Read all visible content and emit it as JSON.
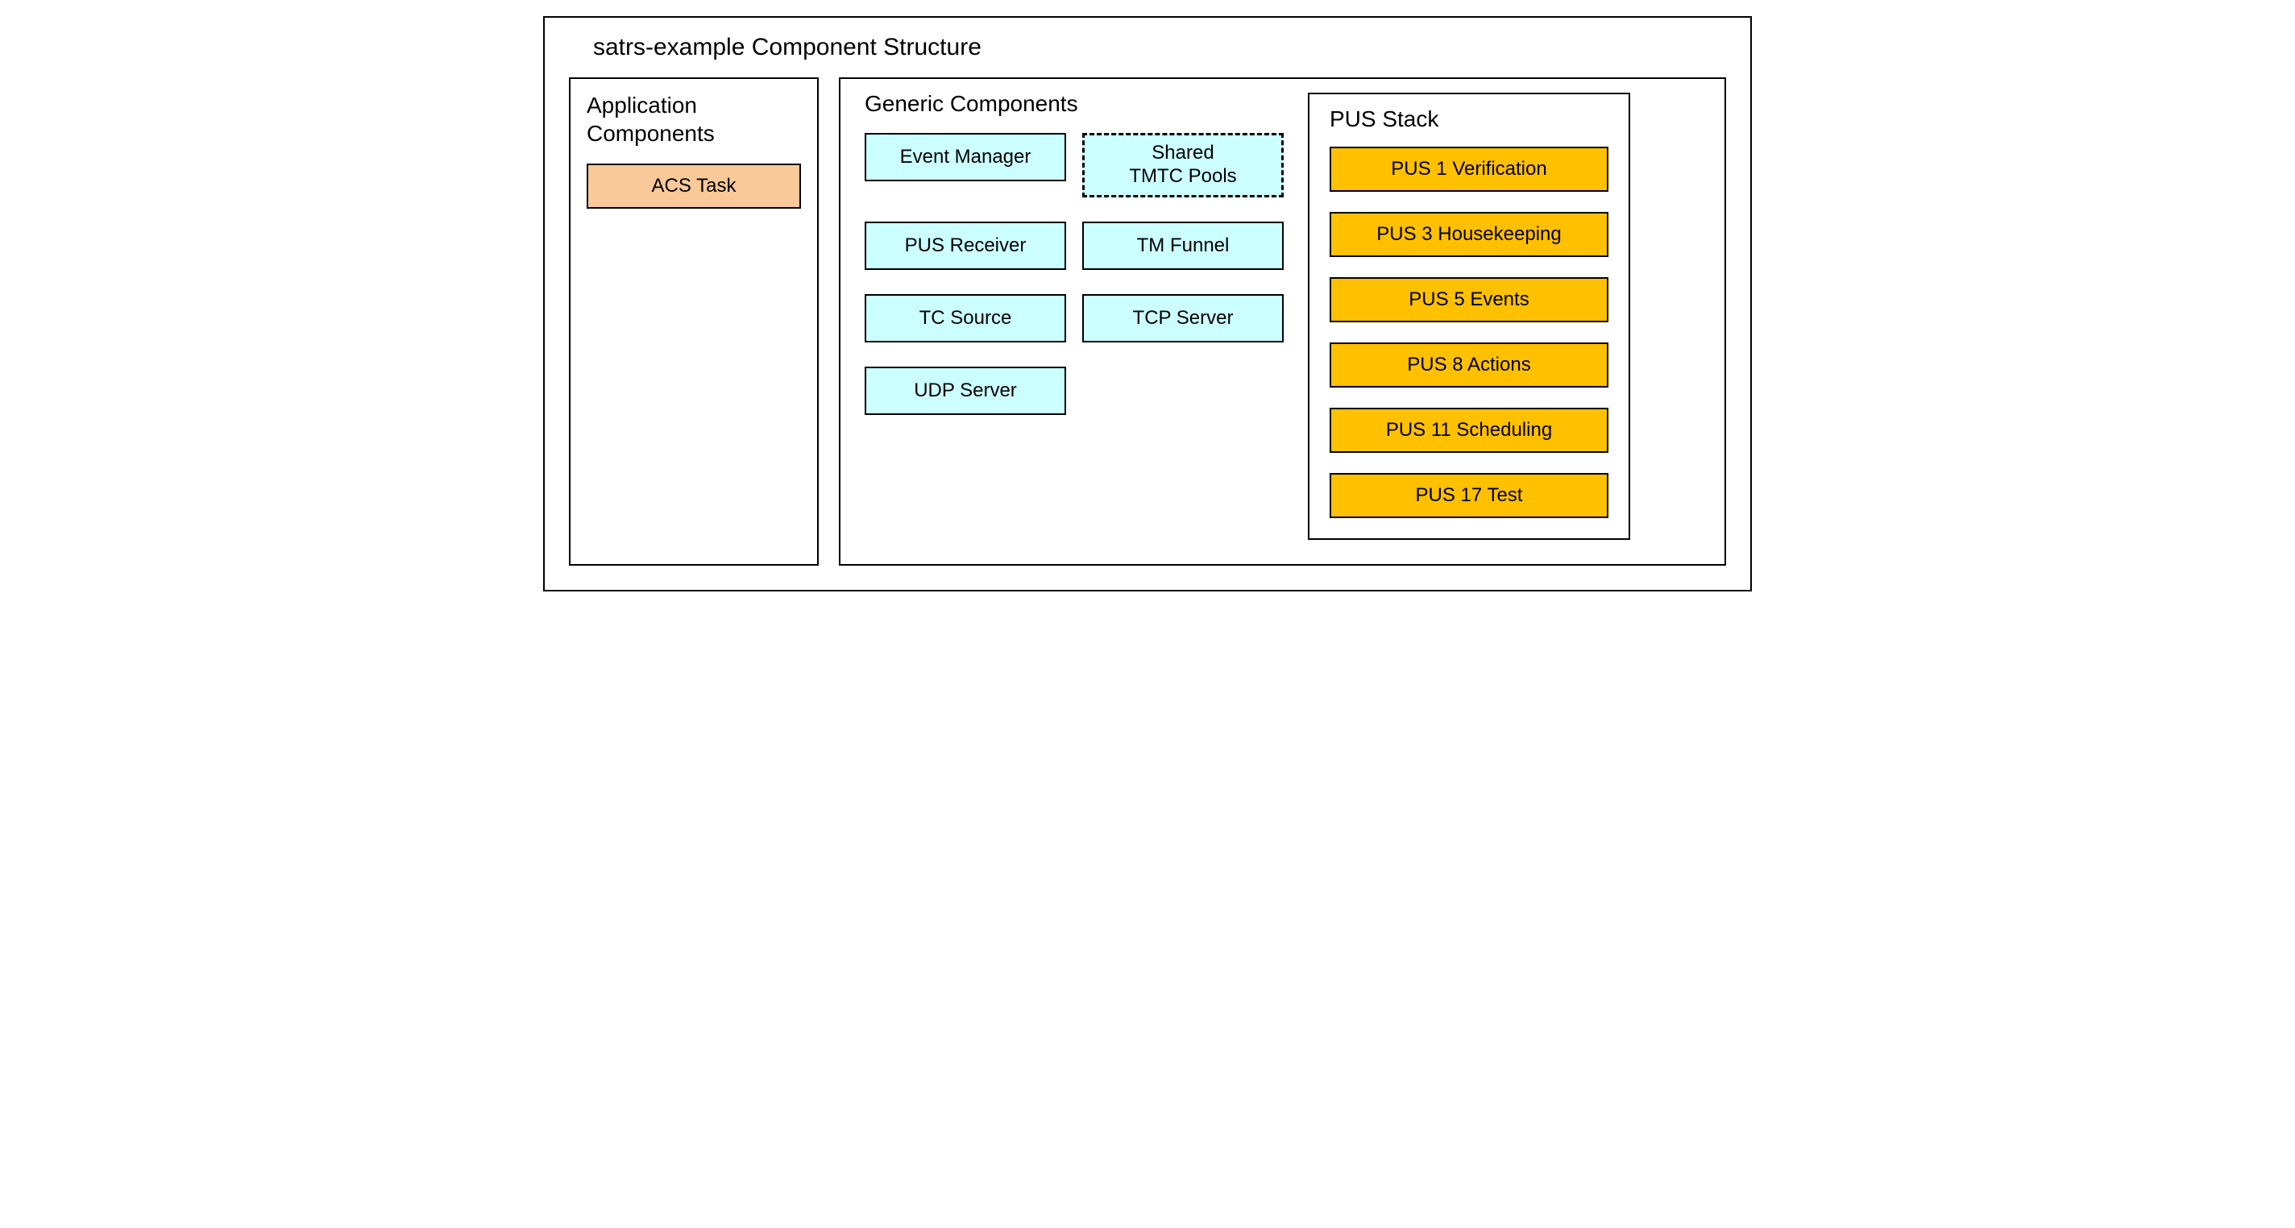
{
  "main_title": "satrs-example Component Structure",
  "app_components": {
    "title": "Application Components",
    "items": [
      {
        "label": "ACS Task"
      }
    ]
  },
  "generic_components": {
    "title": "Generic Components",
    "grid": {
      "event_manager": "Event Manager",
      "shared_tmtc_pools": "Shared\nTMTC Pools",
      "pus_receiver": "PUS Receiver",
      "tm_funnel": "TM Funnel",
      "tc_source": "TC Source",
      "tcp_server": "TCP Server",
      "udp_server": "UDP Server"
    }
  },
  "pus_stack": {
    "title": "PUS Stack",
    "items": [
      {
        "label": "PUS 1 Verification"
      },
      {
        "label": "PUS 3 Housekeeping"
      },
      {
        "label": "PUS 5 Events"
      },
      {
        "label": "PUS 8 Actions"
      },
      {
        "label": "PUS 11 Scheduling"
      },
      {
        "label": "PUS 17 Test"
      }
    ]
  }
}
